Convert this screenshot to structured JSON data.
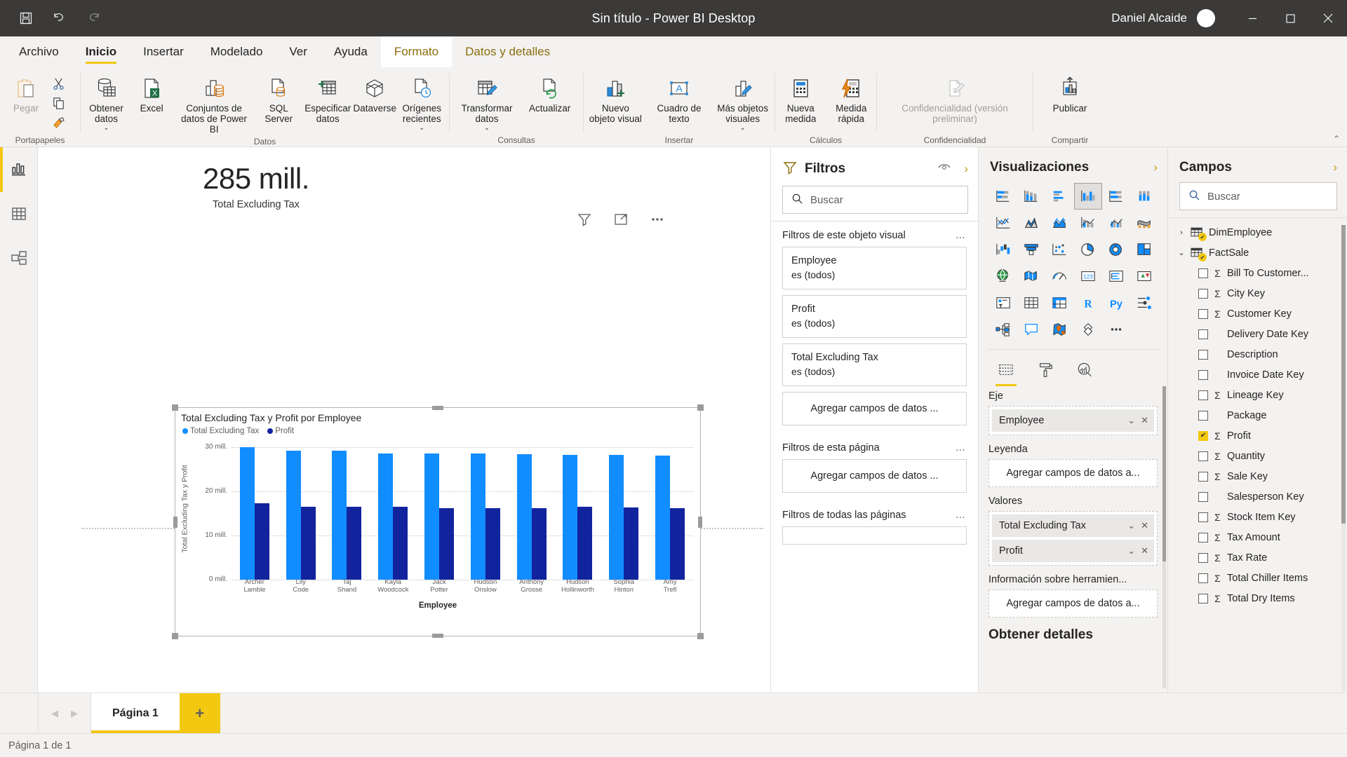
{
  "titlebar": {
    "quick_actions": [
      {
        "name": "save-icon",
        "label": "Guardar"
      },
      {
        "name": "undo-icon",
        "label": "Deshacer"
      },
      {
        "name": "redo-icon",
        "label": "Rehacer"
      }
    ],
    "title": "Sin título - Power BI Desktop",
    "user": "Daniel Alcaide",
    "window_buttons": [
      "minimize-icon",
      "maximize-icon",
      "close-icon"
    ]
  },
  "ribbon_tabs": [
    {
      "label": "Archivo",
      "state": "normal"
    },
    {
      "label": "Inicio",
      "state": "active"
    },
    {
      "label": "Insertar",
      "state": "normal"
    },
    {
      "label": "Modelado",
      "state": "normal"
    },
    {
      "label": "Ver",
      "state": "normal"
    },
    {
      "label": "Ayuda",
      "state": "normal"
    },
    {
      "label": "Formato",
      "state": "contextual"
    },
    {
      "label": "Datos y detalles",
      "state": "contextual"
    }
  ],
  "ribbon": {
    "groups": [
      {
        "name": "Portapapeles",
        "label": "Portapapeles",
        "items": [
          {
            "label": "Pegar",
            "icon": "paste-icon",
            "disabled": true
          },
          {
            "label": "Cortar",
            "icon": "cut-icon",
            "small": true
          },
          {
            "label": "Copiar",
            "icon": "copy-icon",
            "small": true
          },
          {
            "label": "Copiar formato",
            "icon": "format-painter-icon",
            "small": true
          }
        ]
      },
      {
        "name": "Datos",
        "label": "Datos",
        "items": [
          {
            "label": "Obtener datos",
            "icon": "get-data-icon",
            "caret": true
          },
          {
            "label": "Excel",
            "icon": "excel-icon"
          },
          {
            "label": "Conjuntos de datos de Power BI",
            "icon": "powerbi-datasets-icon"
          },
          {
            "label": "SQL Server",
            "icon": "sql-server-icon"
          },
          {
            "label": "Especificar datos",
            "icon": "enter-data-icon"
          },
          {
            "label": "Dataverse",
            "icon": "dataverse-icon"
          },
          {
            "label": "Orígenes recientes",
            "icon": "recent-sources-icon",
            "caret": true
          }
        ]
      },
      {
        "name": "Consultas",
        "label": "Consultas",
        "items": [
          {
            "label": "Transformar datos",
            "icon": "transform-data-icon",
            "caret": true
          },
          {
            "label": "Actualizar",
            "icon": "refresh-icon"
          }
        ]
      },
      {
        "name": "Insertar",
        "label": "Insertar",
        "items": [
          {
            "label": "Nuevo objeto visual",
            "icon": "new-visual-icon"
          },
          {
            "label": "Cuadro de texto",
            "icon": "text-box-icon"
          },
          {
            "label": "Más objetos visuales",
            "icon": "more-visuals-icon",
            "caret": true
          }
        ]
      },
      {
        "name": "Cálculos",
        "label": "Cálculos",
        "items": [
          {
            "label": "Nueva medida",
            "icon": "new-measure-icon"
          },
          {
            "label": "Medida rápida",
            "icon": "quick-measure-icon"
          }
        ]
      },
      {
        "name": "Confidencialidad",
        "label": "Confidencialidad",
        "items": [
          {
            "label": "Confidencialidad (versión preliminar)",
            "icon": "sensitivity-icon",
            "caret": true,
            "disabled": true
          }
        ]
      },
      {
        "name": "Compartir",
        "label": "Compartir",
        "items": [
          {
            "label": "Publicar",
            "icon": "publish-icon"
          }
        ]
      }
    ],
    "collapse_label": "⌃"
  },
  "left_rail": [
    {
      "name": "report-view-icon",
      "label": "Informe",
      "active": true
    },
    {
      "name": "data-view-icon",
      "label": "Datos",
      "active": false
    },
    {
      "name": "model-view-icon",
      "label": "Modelo",
      "active": false
    }
  ],
  "canvas": {
    "kpi": {
      "value": "285 mill.",
      "label": "Total Excluding Tax"
    },
    "visual_header_icons": [
      "filter-icon",
      "focus-mode-icon",
      "more-options-icon"
    ]
  },
  "chart_data": {
    "type": "bar",
    "title": "Total Excluding Tax y Profit por Employee",
    "xlabel": "Employee",
    "ylabel": "Total Excluding Tax y Profit",
    "ylim": [
      0,
      32000000
    ],
    "yticks": [
      "0 mill.",
      "10 mill.",
      "20 mill.",
      "30 mill."
    ],
    "ytick_values": [
      0,
      10000000,
      20000000,
      30000000
    ],
    "grid": true,
    "legend_position": "top-left",
    "categories": [
      "Archer Lamble",
      "Lily Code",
      "Taj Shand",
      "Kayla Woodcock",
      "Jack Potter",
      "Hudson Onslow",
      "Anthony Grosse",
      "Hudson Hollinworth",
      "Sophia Hinton",
      "Amy Trefl"
    ],
    "series": [
      {
        "name": "Total Excluding Tax",
        "color": "#118dff",
        "values": [
          29900000,
          29100000,
          29100000,
          28500000,
          28500000,
          28500000,
          28400000,
          28200000,
          28200000,
          28000000
        ]
      },
      {
        "name": "Profit",
        "color": "#12239e",
        "values": [
          17200000,
          16500000,
          16500000,
          16500000,
          16200000,
          16200000,
          16100000,
          16400000,
          16300000,
          16200000
        ]
      }
    ]
  },
  "filters_panel": {
    "icon": "filter-funnel-icon",
    "title": "Filtros",
    "header_icons": [
      "hide-filters-icon",
      "expand-chevron-icon"
    ],
    "search": {
      "placeholder": "Buscar",
      "value": "",
      "icon": "search-icon"
    },
    "sections": [
      {
        "heading": "Filtros de este objeto visual",
        "more": "…",
        "cards": [
          {
            "name": "Employee",
            "value": "es (todos)"
          },
          {
            "name": "Profit",
            "value": "es (todos)"
          },
          {
            "name": "Total Excluding Tax",
            "value": "es (todos)"
          }
        ],
        "drop_placeholder": "Agregar campos de datos ..."
      },
      {
        "heading": "Filtros de esta página",
        "more": "…",
        "cards": [],
        "drop_placeholder": "Agregar campos de datos ..."
      },
      {
        "heading": "Filtros de todas las páginas",
        "more": "…",
        "cards": [],
        "drop_placeholder": ""
      }
    ]
  },
  "visualizations_panel": {
    "title": "Visualizaciones",
    "collapse_icon": "expand-chevron-icon",
    "gallery": [
      "stacked-bar-chart-icon",
      "stacked-column-chart-icon",
      "clustered-bar-chart-icon",
      "clustered-column-chart-icon",
      "100-stacked-bar-chart-icon",
      "100-stacked-column-chart-icon",
      "line-chart-icon",
      "area-chart-icon",
      "stacked-area-chart-icon",
      "line-stacked-column-icon",
      "line-clustered-column-icon",
      "ribbon-chart-icon",
      "waterfall-chart-icon",
      "funnel-chart-icon",
      "scatter-chart-icon",
      "pie-chart-icon",
      "donut-chart-icon",
      "treemap-icon",
      "map-icon",
      "filled-map-icon",
      "gauge-icon",
      "card-icon",
      "multi-row-card-icon",
      "kpi-icon",
      "slicer-icon",
      "table-icon",
      "matrix-icon",
      "r-script-visual-icon",
      "python-visual-icon",
      "key-influencers-icon",
      "decomposition-tree-icon",
      "qna-icon",
      "arcgis-map-icon",
      "paginated-report-icon",
      "more-visuals-ellipsis-icon"
    ],
    "selected_index": 3,
    "tabs": [
      {
        "name": "fields-tab-icon",
        "active": true
      },
      {
        "name": "format-paint-roller-icon",
        "active": false
      },
      {
        "name": "analytics-magnifier-icon",
        "active": false
      }
    ],
    "wells": [
      {
        "label": "Eje",
        "chips": [
          {
            "name": "Employee"
          }
        ],
        "placeholder": ""
      },
      {
        "label": "Leyenda",
        "chips": [],
        "placeholder": "Agregar campos de datos a..."
      },
      {
        "label": "Valores",
        "chips": [
          {
            "name": "Total Excluding Tax"
          },
          {
            "name": "Profit"
          }
        ],
        "placeholder": ""
      },
      {
        "label": "Información sobre herramien...",
        "chips": [],
        "placeholder": "Agregar campos de datos a..."
      }
    ],
    "footer_heading": "Obtener detalles"
  },
  "fields_panel": {
    "title": "Campos",
    "collapse_icon": "expand-chevron-icon",
    "search": {
      "placeholder": "Buscar",
      "value": "",
      "icon": "search-icon"
    },
    "tables": [
      {
        "name": "DimEmployee",
        "expanded": false,
        "twisty": "›",
        "fields": []
      },
      {
        "name": "FactSale",
        "expanded": true,
        "twisty": "⌄",
        "fields": [
          {
            "label": "Bill To Customer...",
            "checked": false,
            "aggregate": true
          },
          {
            "label": "City Key",
            "checked": false,
            "aggregate": true
          },
          {
            "label": "Customer Key",
            "checked": false,
            "aggregate": true
          },
          {
            "label": "Delivery Date Key",
            "checked": false,
            "aggregate": false
          },
          {
            "label": "Description",
            "checked": false,
            "aggregate": false
          },
          {
            "label": "Invoice Date Key",
            "checked": false,
            "aggregate": false
          },
          {
            "label": "Lineage Key",
            "checked": false,
            "aggregate": true
          },
          {
            "label": "Package",
            "checked": false,
            "aggregate": false
          },
          {
            "label": "Profit",
            "checked": true,
            "aggregate": true
          },
          {
            "label": "Quantity",
            "checked": false,
            "aggregate": true
          },
          {
            "label": "Sale Key",
            "checked": false,
            "aggregate": true
          },
          {
            "label": "Salesperson Key",
            "checked": false,
            "aggregate": false
          },
          {
            "label": "Stock Item Key",
            "checked": false,
            "aggregate": true
          },
          {
            "label": "Tax Amount",
            "checked": false,
            "aggregate": true
          },
          {
            "label": "Tax Rate",
            "checked": false,
            "aggregate": true
          },
          {
            "label": "Total Chiller Items",
            "checked": false,
            "aggregate": true
          },
          {
            "label": "Total Dry Items",
            "checked": false,
            "aggregate": true
          }
        ]
      }
    ]
  },
  "page_tabs": {
    "prev_icon": "chevron-left-icon",
    "next_icon": "chevron-right-icon",
    "tabs": [
      {
        "label": "Página 1",
        "active": true
      }
    ],
    "add_label": "+"
  },
  "status_bar": {
    "text": "Página 1 de 1"
  },
  "colors": {
    "accent_yellow": "#f2c811",
    "series_1": "#118dff",
    "series_2": "#12239e",
    "chrome_gray": "#f3f2f1",
    "titlebar": "#3b3a39"
  }
}
